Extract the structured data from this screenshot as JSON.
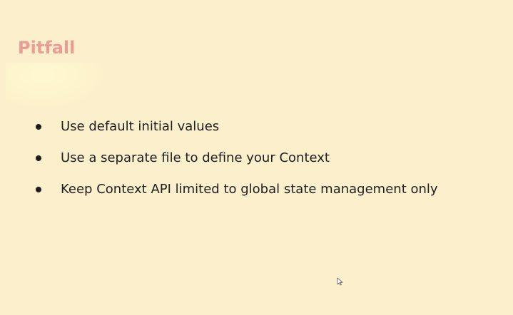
{
  "slide": {
    "title": "Pitfall",
    "bullets": [
      "Use default initial values",
      "Use a separate file to define your Context",
      "Keep Context API limited to global state management only"
    ]
  },
  "colors": {
    "background": "#fcefcc",
    "title": "#ec9c94",
    "text": "#1e1e1e"
  },
  "icons": {
    "cursor": "mouse-pointer-icon",
    "bullet": "bullet-dot-icon"
  }
}
